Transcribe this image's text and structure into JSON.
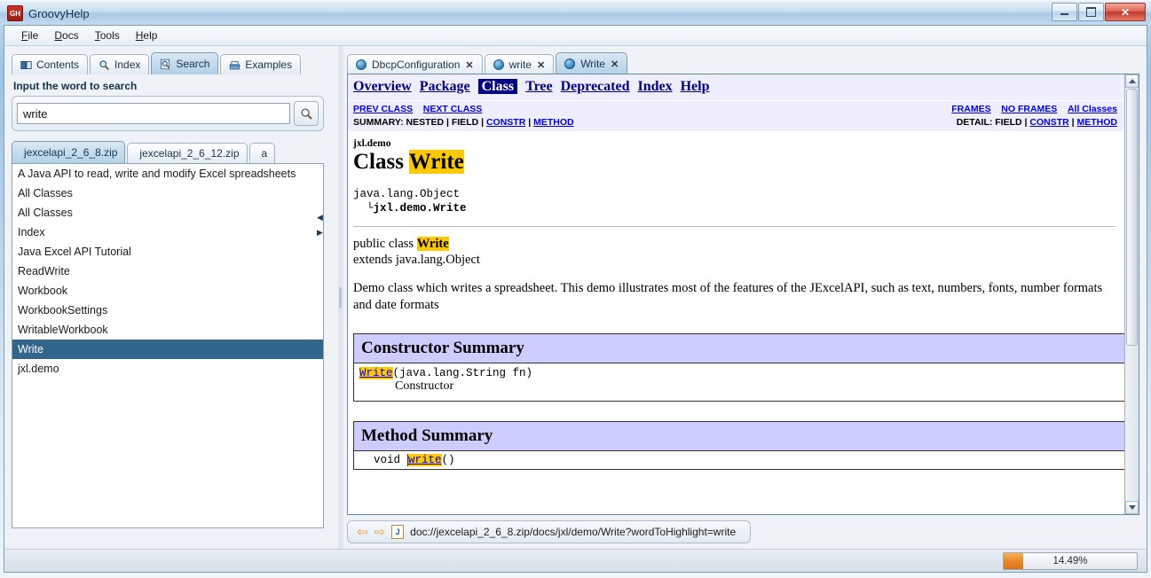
{
  "window": {
    "title": "GroovyHelp",
    "app_icon": "GH",
    "buttons": {
      "minimize": "minimize-icon",
      "maximize": "maximize-icon",
      "close": "close-icon"
    }
  },
  "menubar": {
    "items": [
      "File",
      "Docs",
      "Tools",
      "Help"
    ]
  },
  "left_panel": {
    "tabs": [
      {
        "label": "Contents",
        "icon": "book-icon",
        "selected": false
      },
      {
        "label": "Index",
        "icon": "magnifier-icon",
        "selected": false
      },
      {
        "label": "Search",
        "icon": "search-doc-icon",
        "selected": true
      },
      {
        "label": "Examples",
        "icon": "examples-icon",
        "selected": false
      }
    ],
    "search_label": "Input the word to search",
    "search_value": "write",
    "search_placeholder": "Input the word to search",
    "search_button_icon": "magnifier-icon",
    "zip_tabs": [
      {
        "label": "jexcelapi_2_6_8.zip",
        "icon": "package-icon",
        "selected": true
      },
      {
        "label": "jexcelapi_2_6_12.zip",
        "icon": "package-icon",
        "selected": false
      },
      {
        "label": "a",
        "icon": "package-icon",
        "selected": false
      }
    ],
    "zip_tab_scroll_left": "◀",
    "zip_tab_scroll_right": "▶",
    "results": [
      {
        "label": "A Java API to read, write and modify Excel spreadsheets",
        "selected": false
      },
      {
        "label": "All Classes",
        "selected": false
      },
      {
        "label": "All Classes",
        "selected": false
      },
      {
        "label": "Index",
        "selected": false
      },
      {
        "label": "Java Excel API Tutorial",
        "selected": false
      },
      {
        "label": "ReadWrite",
        "selected": false
      },
      {
        "label": "Workbook",
        "selected": false
      },
      {
        "label": "WorkbookSettings",
        "selected": false
      },
      {
        "label": "WritableWorkbook",
        "selected": false
      },
      {
        "label": "Write",
        "selected": true
      },
      {
        "label": "jxl.demo",
        "selected": false
      }
    ]
  },
  "right_panel": {
    "doc_tabs": [
      {
        "label": "DbcpConfiguration",
        "icon": "globe-icon",
        "close": "✕",
        "selected": false
      },
      {
        "label": "write",
        "icon": "globe-icon",
        "close": "✕",
        "selected": false
      },
      {
        "label": "Write",
        "icon": "globe-icon",
        "close": "✕",
        "selected": true
      }
    ],
    "javadoc": {
      "nav_main": [
        {
          "label": "Overview",
          "current": false
        },
        {
          "label": "Package",
          "current": false
        },
        {
          "label": "Class",
          "current": true
        },
        {
          "label": "Tree",
          "current": false
        },
        {
          "label": "Deprecated",
          "current": false
        },
        {
          "label": "Index",
          "current": false
        },
        {
          "label": "Help",
          "current": false
        }
      ],
      "prev_class": "PREV CLASS",
      "next_class": "NEXT CLASS",
      "frames": "FRAMES",
      "no_frames": "NO FRAMES",
      "all_classes": "All Classes",
      "summary_prefix": "SUMMARY: NESTED | FIELD | ",
      "summary_constr": "CONSTR",
      "summary_sep": " | ",
      "summary_method": "METHOD",
      "detail_prefix": "DETAIL: FIELD | ",
      "detail_constr": "CONSTR",
      "detail_sep": " | ",
      "detail_method": "METHOD",
      "package_name": "jxl.demo",
      "class_heading_prefix": "Class ",
      "class_heading_name": "Write",
      "hierarchy_root": "java.lang.Object",
      "hierarchy_branch": "└",
      "hierarchy_leaf": "jxl.demo.Write",
      "declaration_line1_prefix": "public class ",
      "declaration_line1_name": "Write",
      "declaration_line2": "extends java.lang.Object",
      "description": "Demo class which writes a spreadsheet. This demo illustrates most of the features of the JExcelAPI, such as text, numbers, fonts, number formats and date formats",
      "constructor_summary_title": "Constructor Summary",
      "constructor_link": "Write",
      "constructor_args": "(java.lang.String fn)",
      "constructor_desc": "Constructor",
      "method_summary_title": "Method Summary",
      "method_return_type": "void",
      "method_link": "write",
      "method_args": "()"
    },
    "address_bar": {
      "back_icon": "⇦",
      "forward_icon": "⇨",
      "page_icon": "J",
      "url": "doc://jexcelapi_2_6_8.zip/docs/jxl/demo/Write?wordToHighlight=write"
    }
  },
  "status_bar": {
    "progress_text": "14.49%",
    "progress_percent": 14.49
  },
  "colors": {
    "selection_blue": "#31658c",
    "highlight_yellow": "#ffc800",
    "javadoc_nav_bg": "#eeeeff",
    "javadoc_table_header": "#ccccff",
    "link_blue": "#0000ee",
    "nav_current_bg": "#000080",
    "progress_orange": "#e8852a"
  }
}
